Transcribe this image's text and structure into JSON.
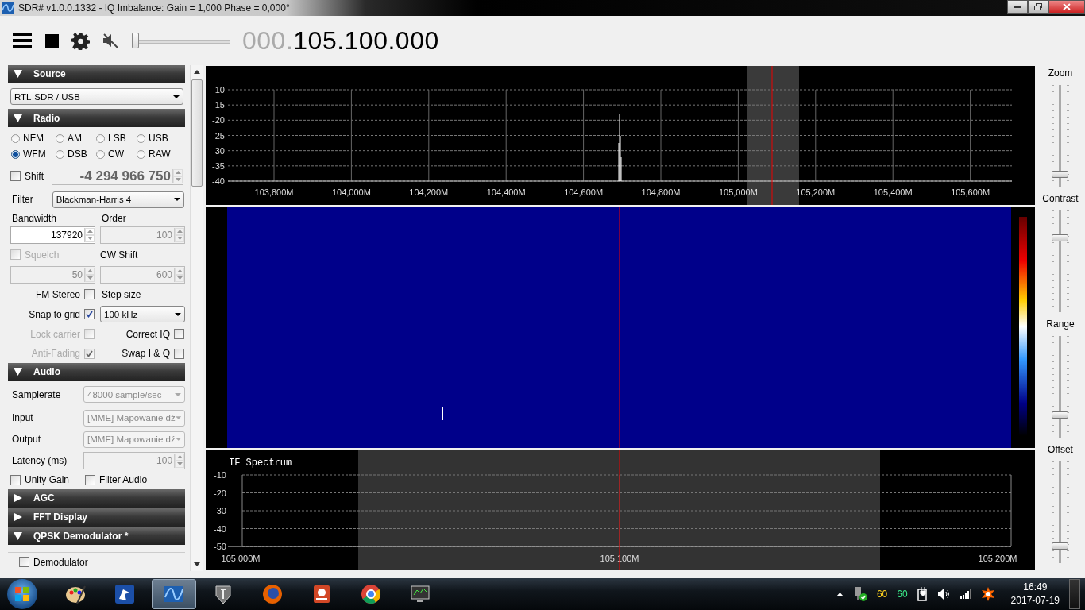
{
  "window": {
    "title": "SDR# v1.0.0.1332 - IQ Imbalance: Gain = 1,000 Phase = 0,000°"
  },
  "toolbar": {
    "volume": {
      "level": 0
    },
    "frequency": {
      "prefix": "000.",
      "value": "105.100.000"
    }
  },
  "source": {
    "title": "Source",
    "expanded": true,
    "device": "RTL-SDR / USB"
  },
  "radio": {
    "title": "Radio",
    "expanded": true,
    "modes": [
      {
        "label": "NFM",
        "selected": false
      },
      {
        "label": "AM",
        "selected": false
      },
      {
        "label": "LSB",
        "selected": false
      },
      {
        "label": "USB",
        "selected": false
      },
      {
        "label": "WFM",
        "selected": true
      },
      {
        "label": "DSB",
        "selected": false
      },
      {
        "label": "CW",
        "selected": false
      },
      {
        "label": "RAW",
        "selected": false
      }
    ],
    "shift": {
      "label": "Shift",
      "checked": false,
      "disabled": false,
      "value": "-4 294 966 750"
    },
    "filter": {
      "label": "Filter",
      "value": "Blackman-Harris 4"
    },
    "bandwidth": {
      "label": "Bandwidth",
      "value": "137920",
      "disabled": false
    },
    "order": {
      "label": "Order",
      "value": "100",
      "disabled": true
    },
    "squelch": {
      "label": "Squelch",
      "checked": false,
      "disabled": true,
      "value": "50"
    },
    "cw_shift": {
      "label": "CW Shift",
      "value": "600",
      "disabled": true
    },
    "fm_stereo": {
      "label": "FM Stereo",
      "checked": false,
      "disabled": false
    },
    "step_size": {
      "label": "Step size",
      "value": "100 kHz"
    },
    "snap_to_grid": {
      "label": "Snap to grid",
      "checked": true,
      "disabled": false
    },
    "lock_carrier": {
      "label": "Lock carrier",
      "checked": false,
      "disabled": true
    },
    "correct_iq": {
      "label": "Correct IQ",
      "checked": false,
      "disabled": false
    },
    "anti_fading": {
      "label": "Anti-Fading",
      "checked": true,
      "disabled": true
    },
    "swap_iq": {
      "label": "Swap I & Q",
      "checked": false,
      "disabled": false
    }
  },
  "audio": {
    "title": "Audio",
    "expanded": true,
    "samplerate": {
      "label": "Samplerate",
      "value": "48000 sample/sec",
      "disabled": true
    },
    "input": {
      "label": "Input",
      "value": "[MME] Mapowanie dź",
      "disabled": true
    },
    "output": {
      "label": "Output",
      "value": "[MME] Mapowanie dź",
      "disabled": true
    },
    "latency": {
      "label": "Latency (ms)",
      "value": "100",
      "disabled": true
    },
    "unity_gain": {
      "label": "Unity Gain",
      "checked": false,
      "disabled": false
    },
    "filter_audio": {
      "label": "Filter Audio",
      "checked": false,
      "disabled": false
    }
  },
  "sections": [
    {
      "title": "AGC",
      "expanded": false
    },
    {
      "title": "FFT Display",
      "expanded": false
    },
    {
      "title": "QPSK Demodulator *",
      "expanded": true
    }
  ],
  "qpsk": {
    "demodulator": {
      "label": "Demodulator",
      "checked": false,
      "disabled": false
    }
  },
  "spectrum": {
    "y_labels": [
      "-10",
      "-15",
      "-20",
      "-25",
      "-30",
      "-35",
      "-40"
    ],
    "x_labels": [
      "103,800M",
      "104,000M",
      "104,200M",
      "104,400M",
      "104,600M",
      "104,800M",
      "105,000M",
      "105,200M",
      "105,400M",
      "105,600M"
    ]
  },
  "if_spectrum": {
    "title": "IF Spectrum",
    "y_labels": [
      "-10",
      "-20",
      "-30",
      "-40",
      "-50"
    ],
    "x_labels": [
      "105,000M",
      "105,100M",
      "105,200M"
    ]
  },
  "display_controls": [
    {
      "label": "Zoom",
      "level": 0.09
    },
    {
      "label": "Contrast",
      "level": 0.75
    },
    {
      "label": "Range",
      "level": 0.2
    },
    {
      "label": "Offset",
      "level": 0.14
    }
  ],
  "taskbar": {
    "apps": [
      {
        "kind": "palette",
        "selected": false
      },
      {
        "kind": "bird",
        "selected": false
      },
      {
        "kind": "wave",
        "selected": true
      },
      {
        "kind": "tank",
        "selected": false
      },
      {
        "kind": "firefox",
        "selected": false
      },
      {
        "kind": "slides",
        "selected": false
      },
      {
        "kind": "chrome",
        "selected": false
      },
      {
        "kind": "monitor",
        "selected": false
      }
    ]
  },
  "tray": {
    "temps": [
      {
        "text": "60",
        "color": "#ffd21e"
      },
      {
        "text": "60",
        "color": "#3cf08c"
      }
    ],
    "time": "16:49",
    "date": "2017-07-19"
  }
}
